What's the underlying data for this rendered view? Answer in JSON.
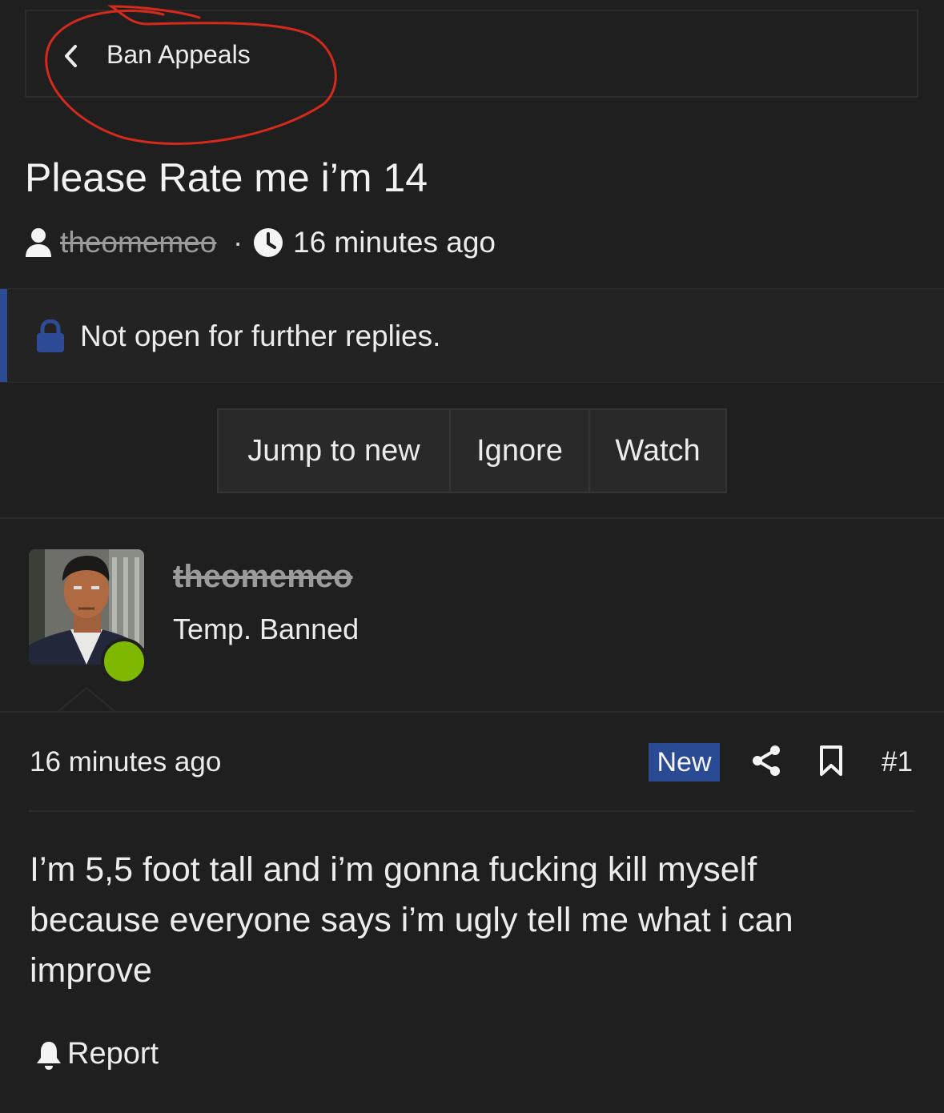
{
  "breadcrumb": {
    "label": "Ban Appeals"
  },
  "thread": {
    "title": "Please Rate me i’m 14",
    "author": "theomemeo",
    "separator": "·",
    "time": "16 minutes ago"
  },
  "notice": {
    "text": "Not open for further replies."
  },
  "actions": {
    "jump": "Jump to new",
    "ignore": "Ignore",
    "watch": "Watch"
  },
  "post": {
    "username": "theomemeo",
    "user_title": "Temp. Banned",
    "time": "16 minutes ago",
    "badge": "New",
    "number": "#1",
    "body": "I’m 5,5 foot tall and i’m gonna fucking kill myself because everyone says i’m ugly tell me what i can improve",
    "report": "Report"
  },
  "colors": {
    "background": "#1f1f1f",
    "accent": "#2b4a94",
    "online": "#7fb800",
    "annotation": "#d42a1c"
  },
  "icons": [
    "chevron-left-icon",
    "user-icon",
    "clock-icon",
    "lock-icon",
    "share-icon",
    "bookmark-icon",
    "bell-icon"
  ]
}
